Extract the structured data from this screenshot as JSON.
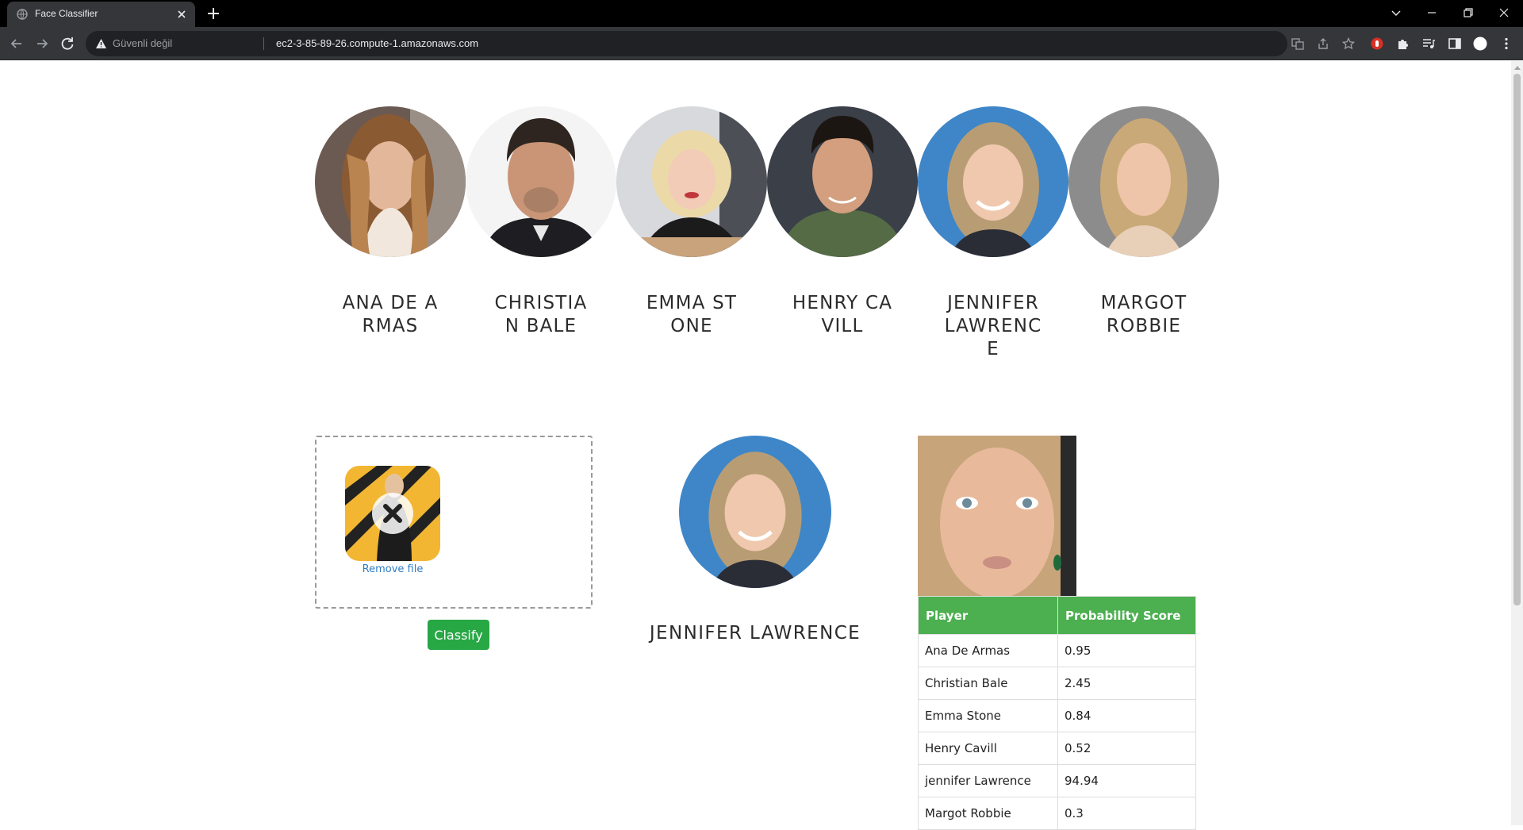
{
  "browser": {
    "tab_title": "Face Classifier",
    "security_label": "Güvenli değil",
    "url": "ec2-3-85-89-26.compute-1.amazonaws.com"
  },
  "celebrities": [
    {
      "name": "Ana De Armas"
    },
    {
      "name": "Christian Bale"
    },
    {
      "name": "Emma Stone"
    },
    {
      "name": "Henry Cavill"
    },
    {
      "name": "Jennifer Lawrence"
    },
    {
      "name": "Margot Robbie"
    }
  ],
  "upload": {
    "remove_label": "Remove file",
    "classify_label": "Classify"
  },
  "result": {
    "name": "Jennifer Lawrence"
  },
  "table": {
    "headers": [
      "Player",
      "Probability Score"
    ],
    "rows": [
      [
        "Ana De Armas",
        "0.95"
      ],
      [
        "Christian Bale",
        "2.45"
      ],
      [
        "Emma Stone",
        "0.84"
      ],
      [
        "Henry Cavill",
        "0.52"
      ],
      [
        "jennifer Lawrence",
        "94.94"
      ],
      [
        "Margot Robbie",
        "0.3"
      ]
    ]
  },
  "colors": {
    "classify_button": "#28a745",
    "table_header": "#4caf50",
    "link": "#2e7bc4"
  }
}
